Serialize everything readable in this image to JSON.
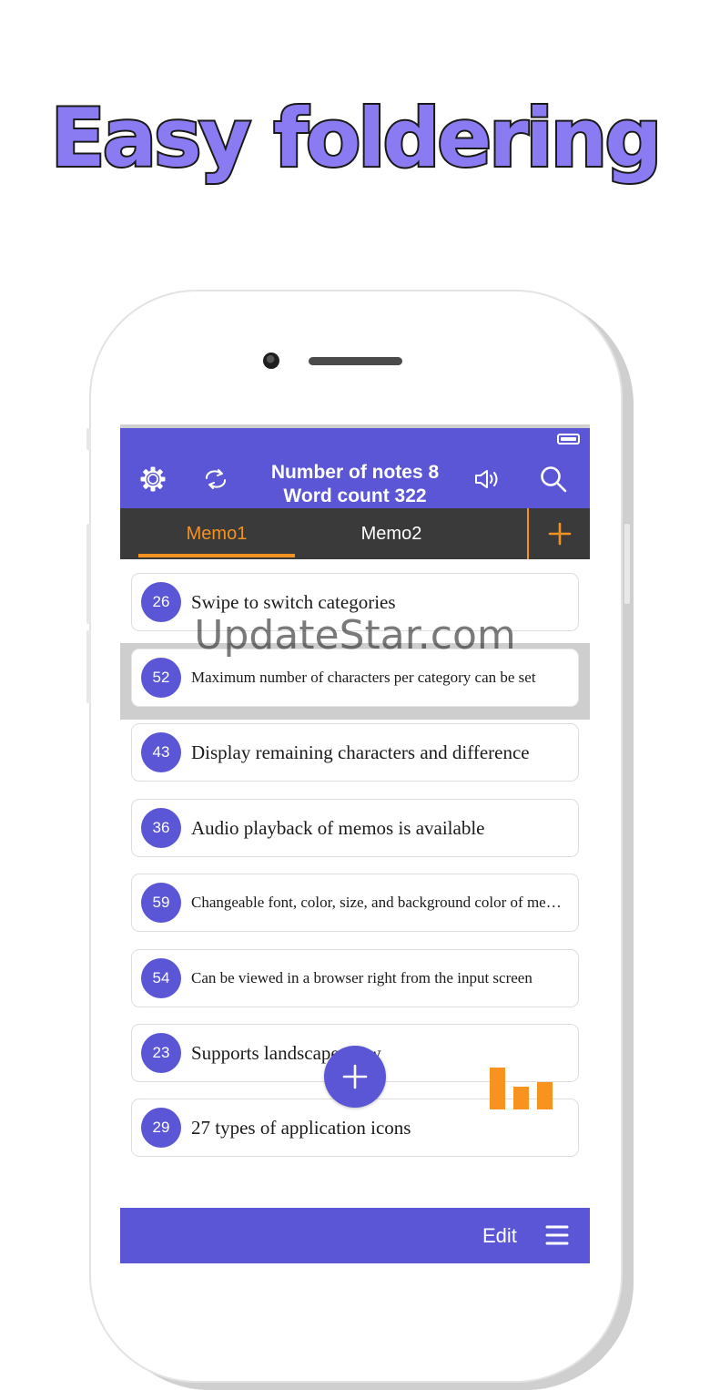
{
  "headline": "Easy foldering",
  "watermark": "UpdateStar.com",
  "header": {
    "title_line1": "Number of notes 8",
    "title_line2": "Word count 322",
    "icons": [
      "gear-icon",
      "sync-icon",
      "speaker-icon",
      "search-icon",
      "battery-icon"
    ]
  },
  "tabs": [
    {
      "label": "Memo1",
      "active": true
    },
    {
      "label": "Memo2",
      "active": false
    }
  ],
  "notes": [
    {
      "count": "26",
      "text": "Swipe to switch categories"
    },
    {
      "count": "52",
      "text": "Maximum number of characters per category can be set",
      "selected": true
    },
    {
      "count": "43",
      "text": "Display remaining characters and difference"
    },
    {
      "count": "36",
      "text": "Audio playback of memos is available"
    },
    {
      "count": "59",
      "text": "Changeable font, color, size, and background color of memos"
    },
    {
      "count": "54",
      "text": "Can be viewed in a browser right from the input screen"
    },
    {
      "count": "23",
      "text": "Supports landscape view"
    },
    {
      "count": "29",
      "text": "27 types of application icons"
    }
  ],
  "stats_bars": [
    0.95,
    0.52,
    0.62
  ],
  "footer": {
    "edit_label": "Edit"
  },
  "colors": {
    "accent": "#5a56d6",
    "orange": "#f39220",
    "tabbar": "#3a3a3a",
    "headline": "#8b7bf2"
  }
}
